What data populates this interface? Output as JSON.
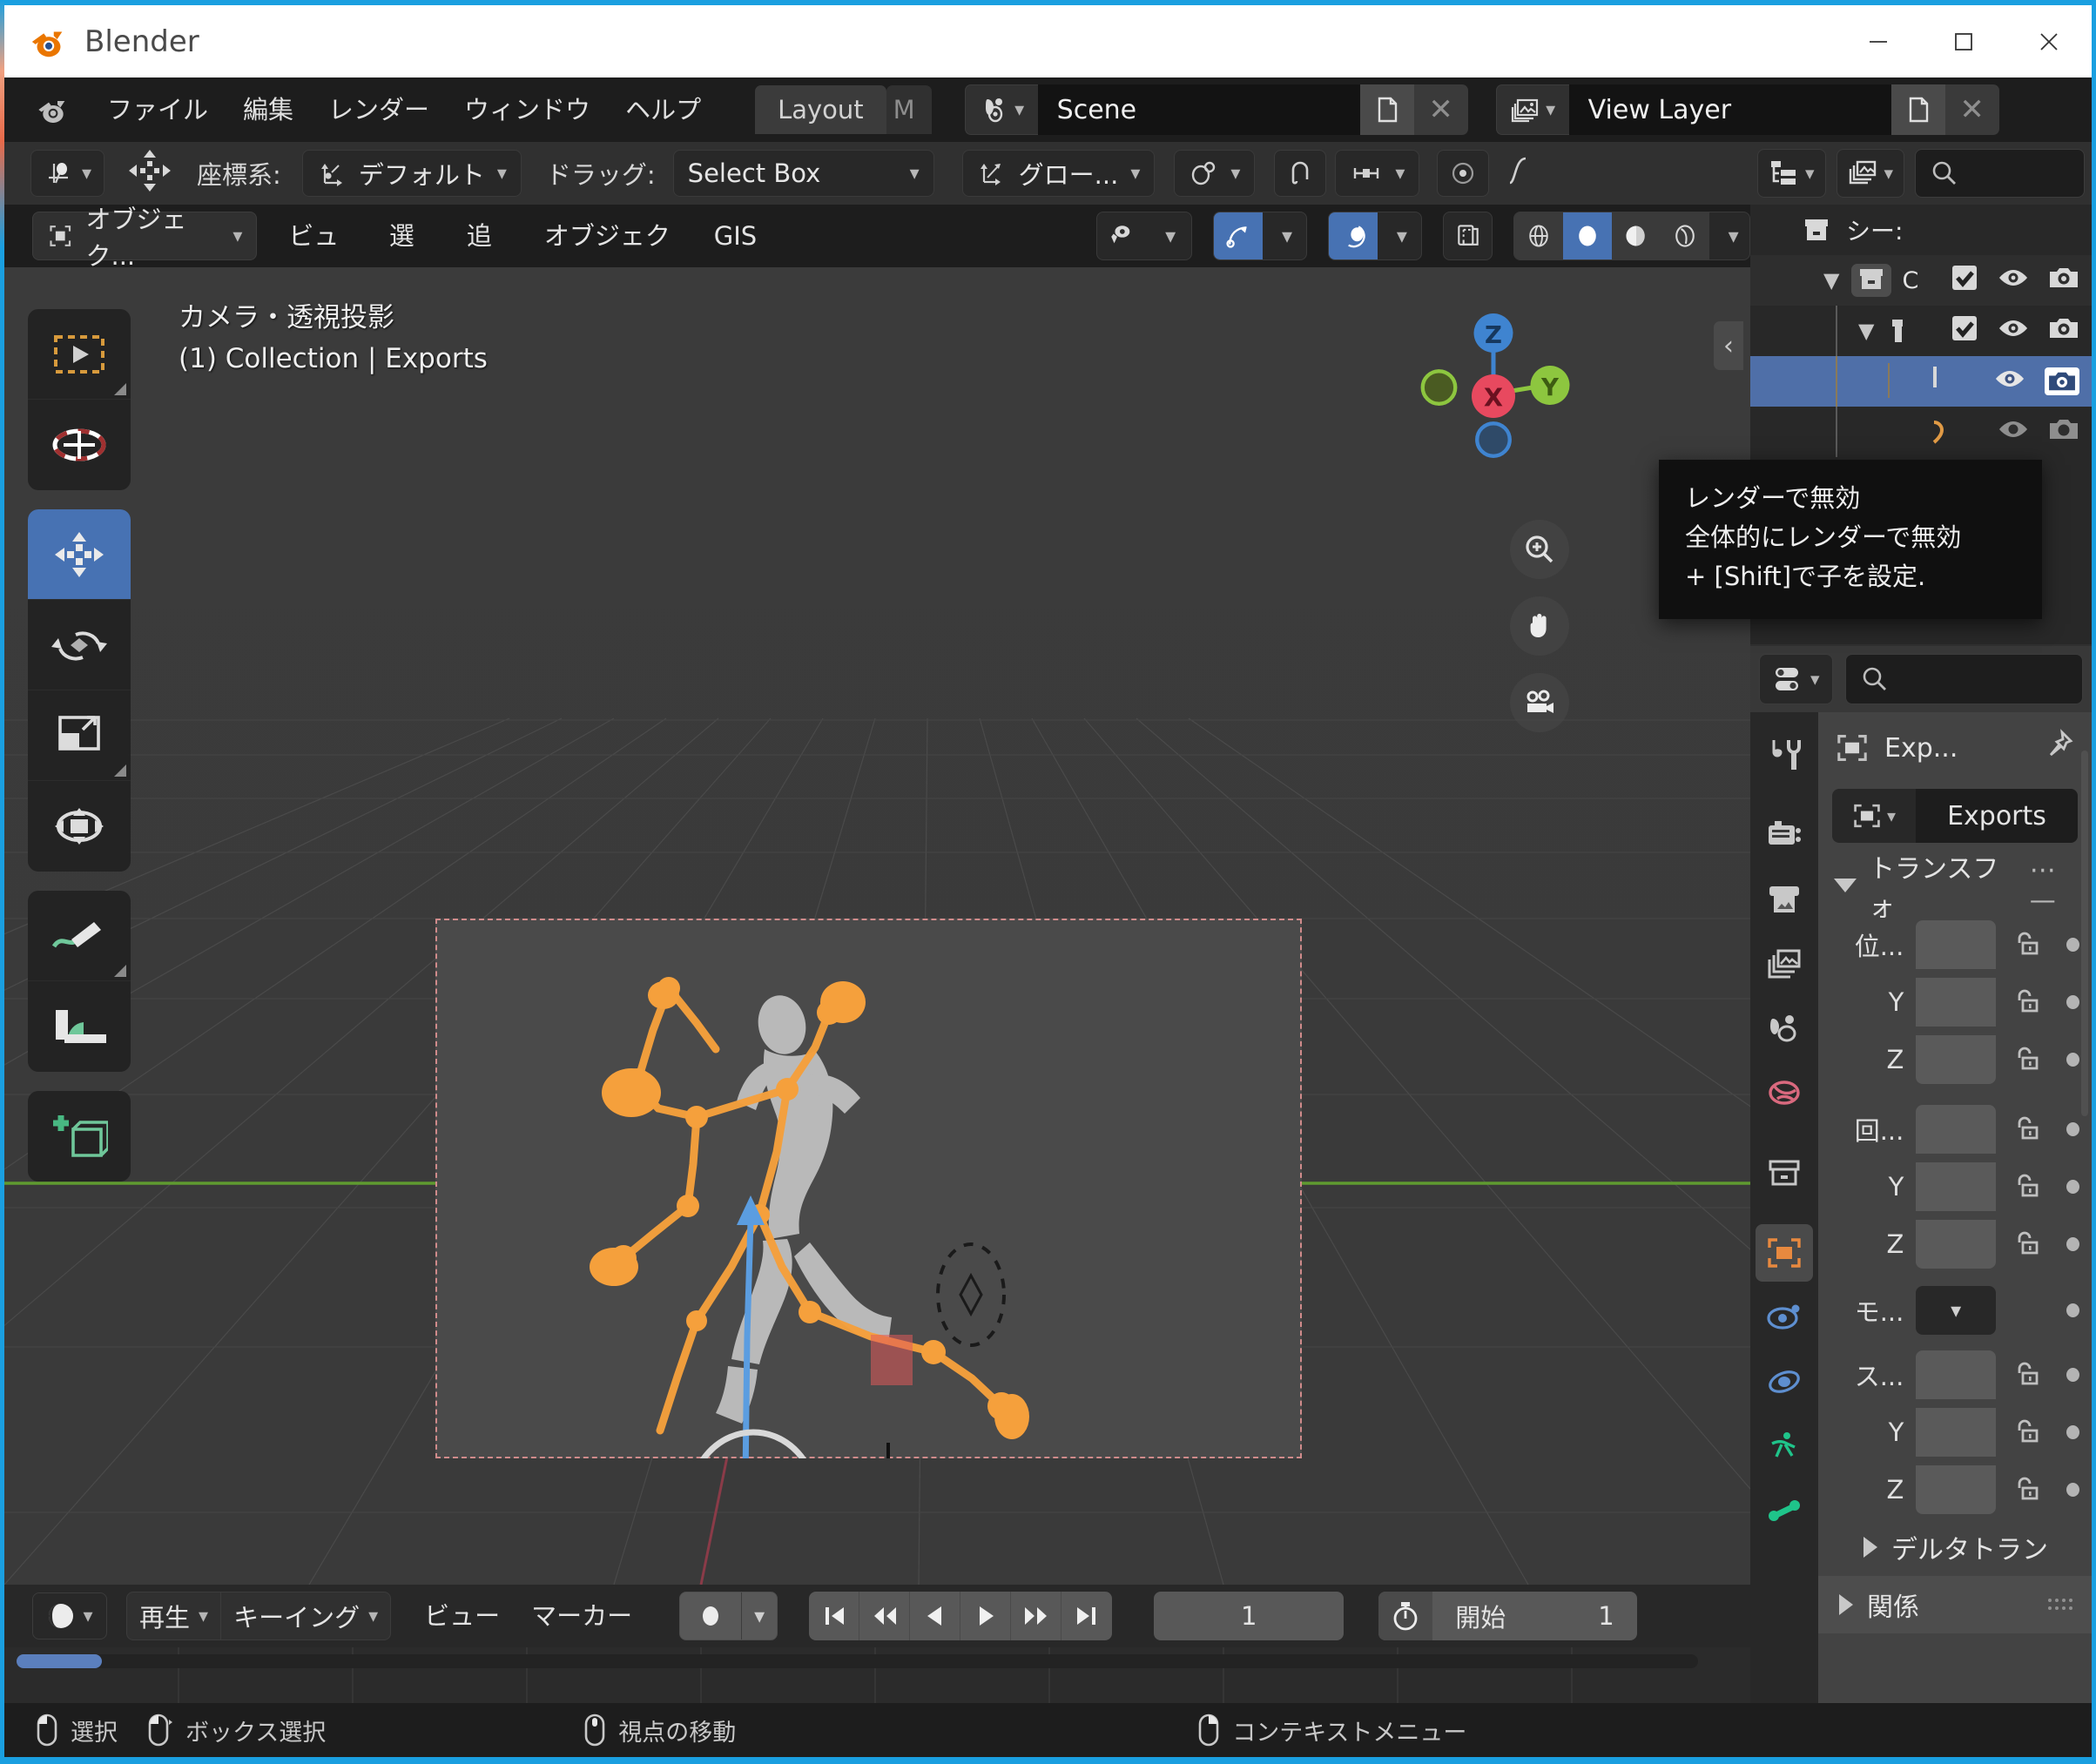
{
  "window": {
    "title": "Blender",
    "minimize": "–",
    "maximize": "☐",
    "close": "✕"
  },
  "top_menu": {
    "items": [
      "ファイル",
      "編集",
      "レンダー",
      "ウィンドウ",
      "ヘルプ"
    ],
    "workspace_tabs": [
      {
        "label": "Layout",
        "active": true
      },
      {
        "label": "M",
        "active": false
      }
    ],
    "scene": {
      "icon": "scene-icon",
      "value": "Scene",
      "new_label": "new-scene-icon",
      "unlink_label": "✕"
    },
    "view_layer": {
      "icon": "viewlayer-icon",
      "value": "View Layer",
      "new_label": "new-viewlayer-icon",
      "unlink_label": "✕"
    }
  },
  "tool_settings": {
    "transform_label": "座標系:",
    "orientation_value": "デフォルト",
    "drag_label": "ドラッグ:",
    "drag_value": "Select Box",
    "global_value": "グロー..."
  },
  "viewport_header": {
    "mode": "オブジェク...",
    "menus": [
      "ビュー",
      "選択",
      "追加",
      "オブジェクト",
      "GIS"
    ]
  },
  "viewport": {
    "view_name": "カメラ・透視投影",
    "context_line": "(1) Collection | Exports",
    "gizmo_axes": [
      "Z",
      "X",
      "Y"
    ],
    "collapse_icon": "‹"
  },
  "toolbar": {
    "tools": [
      {
        "name": "tweak-select-tool",
        "label": "tweak"
      },
      {
        "name": "cursor-tool",
        "label": "cursor"
      },
      {
        "name": "move-tool",
        "label": "move",
        "active": true
      },
      {
        "name": "rotate-tool",
        "label": "rotate"
      },
      {
        "name": "scale-tool",
        "label": "scale"
      },
      {
        "name": "transform-tool",
        "label": "transform"
      },
      {
        "name": "annotate-tool",
        "label": "annotate"
      },
      {
        "name": "measure-tool",
        "label": "measure"
      },
      {
        "name": "add-cube-tool",
        "label": "add cube"
      }
    ]
  },
  "outliner": {
    "display_mode_icon": "outliner-display-icon",
    "filter_icon": "outliner-blendfile-icon",
    "search_placeholder": "",
    "rows": [
      {
        "indent": 0,
        "label": "シー:",
        "icon": "scene-collection-icon",
        "disclosure": "",
        "checkbox": false,
        "eye": false,
        "camera": false,
        "selected": false
      },
      {
        "indent": 1,
        "label": "C",
        "icon": "collection-icon",
        "disclosure": "▼",
        "checkbox": true,
        "eye": true,
        "camera": true,
        "selected": false
      },
      {
        "indent": 2,
        "label": "",
        "icon": "armature-icon",
        "disclosure": "▼",
        "checkbox": true,
        "eye": true,
        "camera": true,
        "selected": false
      },
      {
        "indent": 3,
        "label": "",
        "icon": "pose-icon",
        "disclosure": "",
        "checkbox": false,
        "eye": true,
        "camera": true,
        "selected": true
      }
    ]
  },
  "tooltip": {
    "line1": "レンダーで無効",
    "line2": "全体的にレンダーで無効",
    "line3": "+ [Shift]で子を設定."
  },
  "properties": {
    "editor_icon": "properties-editor-icon",
    "search_placeholder": "",
    "breadcrumb": "Exp...",
    "pin_icon": "pin-icon",
    "object_name": "Exports",
    "tabs": [
      {
        "name": "tool-tab",
        "color": "#c8c8c8"
      },
      {
        "name": "render-tab",
        "color": "#c8c8c8"
      },
      {
        "name": "output-tab",
        "color": "#c8c8c8"
      },
      {
        "name": "viewlayer-tab",
        "color": "#c8c8c8"
      },
      {
        "name": "scene-tab",
        "color": "#c8c8c8"
      },
      {
        "name": "world-tab",
        "color": "#d9697e"
      },
      {
        "name": "collection-tab",
        "color": "#c8c8c8"
      },
      {
        "name": "object-tab",
        "color": "#e8893f",
        "selected": true
      },
      {
        "name": "modifiers-tab",
        "color": "#5e8fd0"
      },
      {
        "name": "physics-tab",
        "color": "#5e8fd0"
      },
      {
        "name": "object-constraints-tab",
        "color": "#1fc48a"
      },
      {
        "name": "object-data-tab",
        "color": "#1fc48a"
      }
    ],
    "transform_panel": {
      "title": "トランスフォ",
      "rows": [
        {
          "label": "位...",
          "kind": "value"
        },
        {
          "label": "Y",
          "kind": "value"
        },
        {
          "label": "Z",
          "kind": "value"
        },
        {
          "label": "回...",
          "kind": "value"
        },
        {
          "label": "Y",
          "kind": "value"
        },
        {
          "label": "Z",
          "kind": "value"
        },
        {
          "label": "モ...",
          "kind": "dropdown"
        },
        {
          "label": "ス...",
          "kind": "value"
        },
        {
          "label": "Y",
          "kind": "value"
        },
        {
          "label": "Z",
          "kind": "value"
        }
      ]
    },
    "delta_transform_label": "デルタトラン",
    "relations_label": "関係"
  },
  "timeline": {
    "editor_icon": "timeline-editor-icon",
    "menus_seg": [
      "再生",
      "キーイング"
    ],
    "menus": [
      "ビュー",
      "マーカー"
    ],
    "record_icon": "record-icon",
    "transport": [
      "jump-start",
      "prev-keyframe",
      "play-reverse",
      "play",
      "next-keyframe",
      "jump-end"
    ],
    "current_frame": "1",
    "range_icon": "stopwatch-icon",
    "start_label": "開始",
    "start_value": "1"
  },
  "status_bar": {
    "items": [
      {
        "icon": "mouse-left-icon",
        "label": "選択"
      },
      {
        "icon": "mouse-left-drag-icon",
        "label": "ボックス選択"
      },
      {
        "icon": "mouse-middle-icon",
        "label": "視点の移動"
      },
      {
        "icon": "mouse-right-icon",
        "label": "コンテキストメニュー"
      }
    ]
  },
  "colors": {
    "accent_blue": "#4772b3",
    "selection_orange": "#f5a03c",
    "window_border": "#1a9fe0",
    "axis_x": "#e44258",
    "axis_y": "#8dc63f",
    "axis_z": "#3f84d0"
  }
}
